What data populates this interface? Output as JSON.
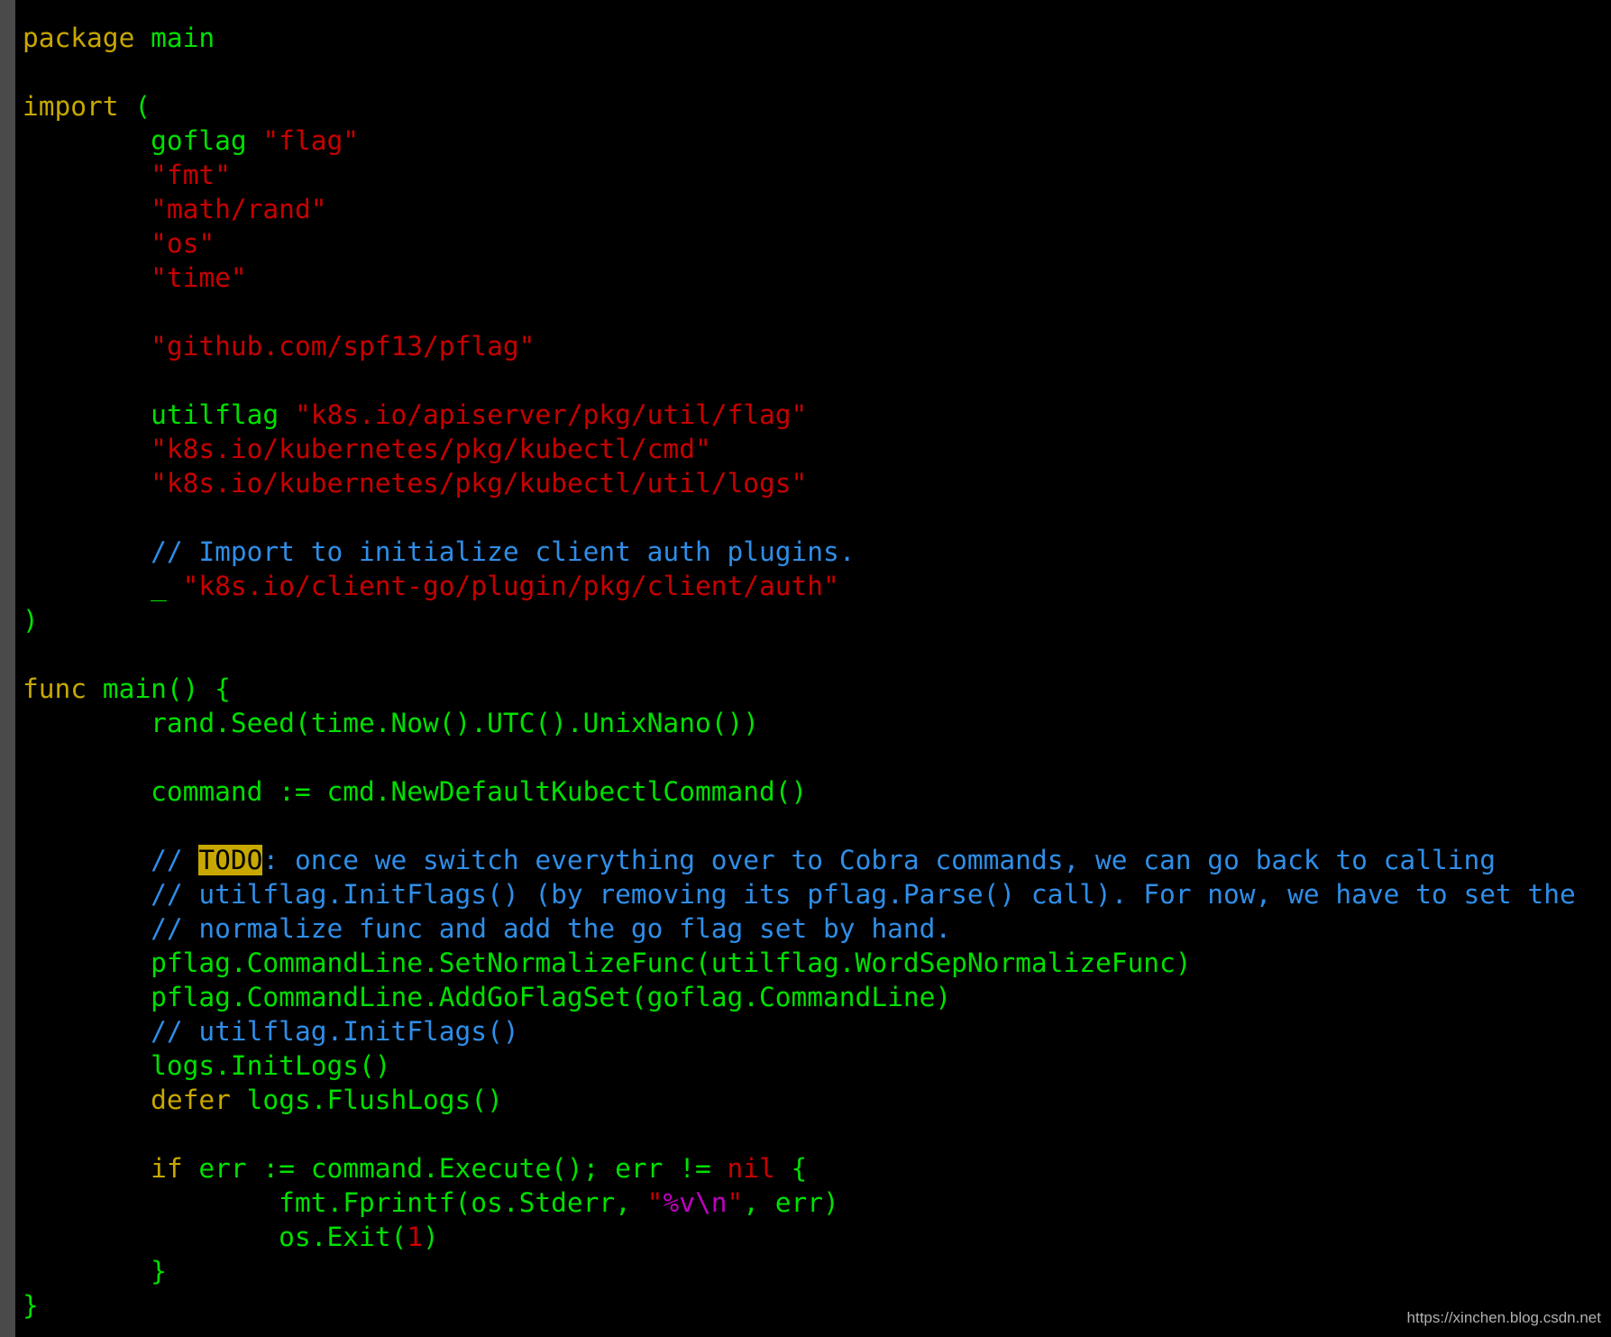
{
  "colors": {
    "keyword": "#c8a800",
    "identifier": "#00e000",
    "string": "#c80000",
    "comment": "#2f8ee8",
    "escape": "#c000c0",
    "todo_bg": "#c8a800",
    "gutter": "#4a4a4a",
    "background": "#000000"
  },
  "editor": {
    "lines": [
      [
        [
          "package",
          "k"
        ],
        [
          " main",
          "g"
        ]
      ],
      [],
      [
        [
          "import",
          "k"
        ],
        [
          " (",
          "g"
        ]
      ],
      [
        [
          "\tgoflag ",
          "g"
        ],
        [
          "\"flag\"",
          "s"
        ]
      ],
      [
        [
          "\t",
          "g"
        ],
        [
          "\"fmt\"",
          "s"
        ]
      ],
      [
        [
          "\t",
          "g"
        ],
        [
          "\"math/rand\"",
          "s"
        ]
      ],
      [
        [
          "\t",
          "g"
        ],
        [
          "\"os\"",
          "s"
        ]
      ],
      [
        [
          "\t",
          "g"
        ],
        [
          "\"time\"",
          "s"
        ]
      ],
      [],
      [
        [
          "\t",
          "g"
        ],
        [
          "\"github.com/spf13/pflag\"",
          "s"
        ]
      ],
      [],
      [
        [
          "\tutilflag ",
          "g"
        ],
        [
          "\"k8s.io/apiserver/pkg/util/flag\"",
          "s"
        ]
      ],
      [
        [
          "\t",
          "g"
        ],
        [
          "\"k8s.io/kubernetes/pkg/kubectl/cmd\"",
          "s"
        ]
      ],
      [
        [
          "\t",
          "g"
        ],
        [
          "\"k8s.io/kubernetes/pkg/kubectl/util/logs\"",
          "s"
        ]
      ],
      [],
      [
        [
          "\t// Import to initialize client auth plugins.",
          "c"
        ]
      ],
      [
        [
          "\t_ ",
          "g"
        ],
        [
          "\"k8s.io/client-go/plugin/pkg/client/auth\"",
          "s"
        ]
      ],
      [
        [
          ")",
          "g"
        ]
      ],
      [],
      [
        [
          "func",
          "k"
        ],
        [
          " main() {",
          "g"
        ]
      ],
      [
        [
          "\trand.Seed(time.Now().UTC().UnixNano())",
          "g"
        ]
      ],
      [],
      [
        [
          "\tcommand := cmd.NewDefaultKubectlCommand()",
          "g"
        ]
      ],
      [],
      [
        [
          "\t// ",
          "c"
        ],
        [
          "TODO",
          "t"
        ],
        [
          ": once we switch everything over to Cobra commands, we can go back to calling",
          "c"
        ]
      ],
      [
        [
          "\t// utilflag.InitFlags() (by removing its pflag.Parse() call). For now, we have to set the",
          "c"
        ]
      ],
      [
        [
          "\t// normalize func and add the go flag set by hand.",
          "c"
        ]
      ],
      [
        [
          "\tpflag.CommandLine.SetNormalizeFunc(utilflag.WordSepNormalizeFunc)",
          "g"
        ]
      ],
      [
        [
          "\tpflag.CommandLine.AddGoFlagSet(goflag.CommandLine)",
          "g"
        ]
      ],
      [
        [
          "\t// utilflag.InitFlags()",
          "c"
        ]
      ],
      [
        [
          "\tlogs.InitLogs()",
          "g"
        ]
      ],
      [
        [
          "\t",
          "g"
        ],
        [
          "defer",
          "k"
        ],
        [
          " logs.FlushLogs()",
          "g"
        ]
      ],
      [],
      [
        [
          "\t",
          "g"
        ],
        [
          "if",
          "k"
        ],
        [
          " err := command.Execute(); err != ",
          "g"
        ],
        [
          "nil",
          "s"
        ],
        [
          " {",
          "g"
        ]
      ],
      [
        [
          "\t\tfmt.Fprintf(os.Stderr, ",
          "g"
        ],
        [
          "\"",
          "s"
        ],
        [
          "%v\\n",
          "m"
        ],
        [
          "\"",
          "s"
        ],
        [
          ", err)",
          "g"
        ]
      ],
      [
        [
          "\t\tos.Exit(",
          "g"
        ],
        [
          "1",
          "s"
        ],
        [
          ")",
          "g"
        ]
      ],
      [
        [
          "\t}",
          "g"
        ]
      ],
      [
        [
          "}",
          "g"
        ]
      ]
    ]
  },
  "watermark": "https://xinchen.blog.csdn.net"
}
